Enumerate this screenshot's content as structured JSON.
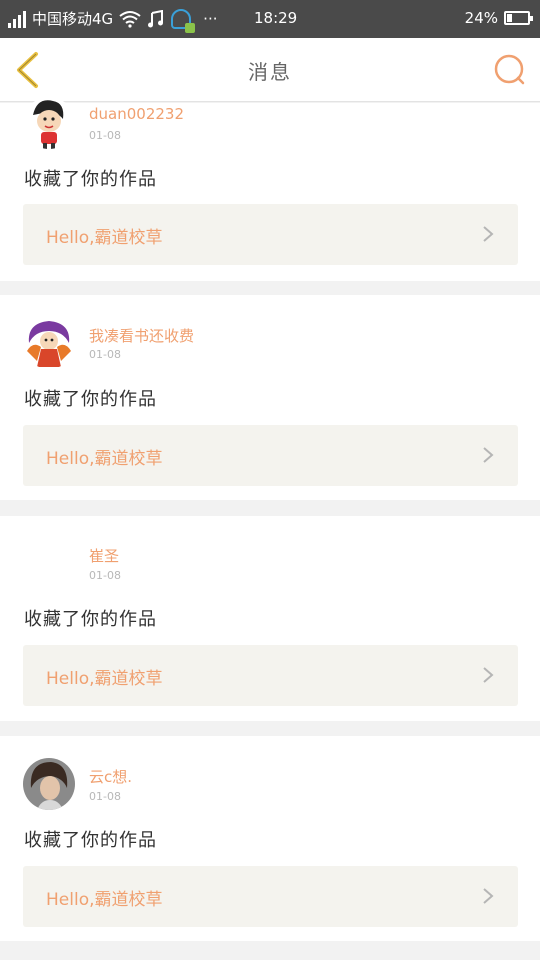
{
  "status_bar": {
    "carrier": "中国移动4G",
    "dots": "···",
    "time": "18:29",
    "battery": "24%",
    "battery_level": 0.24
  },
  "nav": {
    "title": "消息",
    "back_icon": "chevron-left-icon",
    "search_icon": "search-icon"
  },
  "colors": {
    "accent": "#f0a070",
    "back_arrow": "#e8c040",
    "card_link_bg": "#f4f3ee"
  },
  "messages": [
    {
      "username": "duan002232",
      "date": "01-08",
      "text": "收藏了你的作品",
      "work_title": "Hello,霸道校草"
    },
    {
      "username": "我凑看书还收费",
      "date": "01-08",
      "text": "收藏了你的作品",
      "work_title": "Hello,霸道校草"
    },
    {
      "username": "崔圣",
      "date": "01-08",
      "text": "收藏了你的作品",
      "work_title": "Hello,霸道校草"
    },
    {
      "username": "云c想.",
      "date": "01-08",
      "text": "收藏了你的作品",
      "work_title": "Hello,霸道校草"
    }
  ]
}
